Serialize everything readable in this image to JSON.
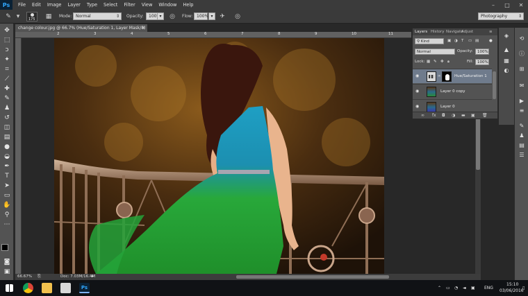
{
  "app": {
    "logo": "Ps",
    "menu": [
      "File",
      "Edit",
      "Image",
      "Layer",
      "Type",
      "Select",
      "Filter",
      "View",
      "Window",
      "Help"
    ],
    "window_controls": [
      "–",
      "□",
      "✕"
    ]
  },
  "options_bar": {
    "brush_size": "175",
    "mode_label": "Mode:",
    "mode_value": "Normal",
    "opacity_label": "Opacity:",
    "opacity_value": "100%",
    "flow_label": "Flow:",
    "flow_value": "100%",
    "workspace": "Photography"
  },
  "document": {
    "tab_title": "change colour.jpg @ 66.7% (Hue/Saturation 1, Layer Mask/8) *",
    "close": "×",
    "ruler_marks": [
      "2",
      "3",
      "4",
      "5",
      "6",
      "7",
      "8",
      "9",
      "10",
      "11"
    ],
    "zoom": "66.67%",
    "doc_info": "Doc: 7.03M/16.4M"
  },
  "layers_panel": {
    "tabs": [
      "Layers",
      "History",
      "Navigato",
      "Adjust"
    ],
    "filter_kind": "Kind",
    "blend_mode": "Normal",
    "opacity_label": "Opacity:",
    "opacity_value": "100%",
    "lock_label": "Lock:",
    "fill_label": "Fill:",
    "fill_value": "100%",
    "layers": [
      {
        "name": "Hue/Saturation 1",
        "selected": true
      },
      {
        "name": "Layer 0 copy",
        "selected": false
      },
      {
        "name": "Layer 0",
        "selected": false
      }
    ],
    "footer_icons": [
      "link-icon",
      "fx-icon",
      "mask-icon",
      "adjustment-icon",
      "folder-icon",
      "new-layer-icon",
      "trash-icon"
    ]
  },
  "taskbar": {
    "language": "ENG",
    "time": "15:10",
    "date": "03/06/2016"
  },
  "colors": {
    "ps_blue": "#31a8ff",
    "selected_layer": "#6f7b8c",
    "dress_green": "#2fa33a",
    "dress_teal": "#1fa3b8"
  }
}
